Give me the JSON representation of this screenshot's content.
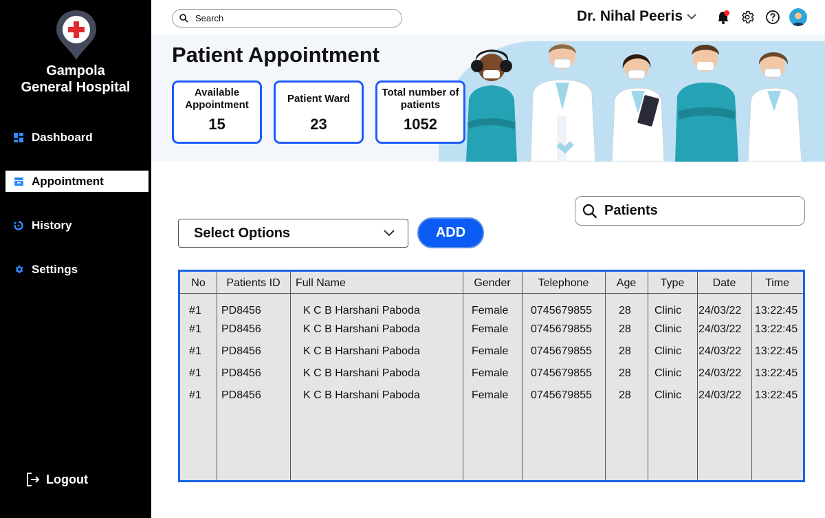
{
  "sidebar": {
    "hospital_name": "Gampola General Hospital",
    "items": [
      {
        "label": "Dashboard",
        "icon": "dashboard-icon"
      },
      {
        "label": "Appointment",
        "icon": "calendar-icon",
        "active": true
      },
      {
        "label": "History",
        "icon": "history-icon"
      },
      {
        "label": "Settings",
        "icon": "gear-icon"
      }
    ],
    "logout_label": "Logout"
  },
  "topbar": {
    "search_placeholder": "Search",
    "doctor_name": "Dr. Nihal Peeris"
  },
  "header": {
    "title": "Patient Appointment",
    "stats": [
      {
        "label": "Available Appointment",
        "value": "15"
      },
      {
        "label": "Patient Ward",
        "value": "23"
      },
      {
        "label": "Total number of patients",
        "value": "1052"
      }
    ]
  },
  "controls": {
    "select_value": "Select Options",
    "add_label": "ADD",
    "patient_search_placeholder": "Patients"
  },
  "table": {
    "columns": [
      "No",
      "Patients ID",
      "Full Name",
      "Gender",
      "Telephone",
      "Age",
      "Type",
      "Date",
      "Time"
    ],
    "rows": [
      [
        "#1",
        "PD8456",
        "K C B Harshani Paboda",
        "Female",
        "0745679855",
        "28",
        "Clinic",
        "24/03/22",
        "13:22:45"
      ],
      [
        "#1",
        "PD8456",
        "K C B Harshani Paboda",
        "Female",
        "0745679855",
        "28",
        "Clinic",
        "24/03/22",
        "13:22:45"
      ],
      [
        "#1",
        "PD8456",
        "K C B Harshani Paboda",
        "Female",
        "0745679855",
        "28",
        "Clinic",
        "24/03/22",
        "13:22:45"
      ],
      [
        "#1",
        "PD8456",
        "K C B Harshani Paboda",
        "Female",
        "0745679855",
        "28",
        "Clinic",
        "24/03/22",
        "13:22:45"
      ],
      [
        "#1",
        "PD8456",
        "K C B Harshani Paboda",
        "Female",
        "0745679855",
        "28",
        "Clinic",
        "24/03/22",
        "13:22:45"
      ]
    ]
  },
  "colors": {
    "accent": "#0a5cf5",
    "sidebar_bg": "#000000",
    "table_bg": "#e5e5e5",
    "notification_dot": "#ff1f1f"
  }
}
